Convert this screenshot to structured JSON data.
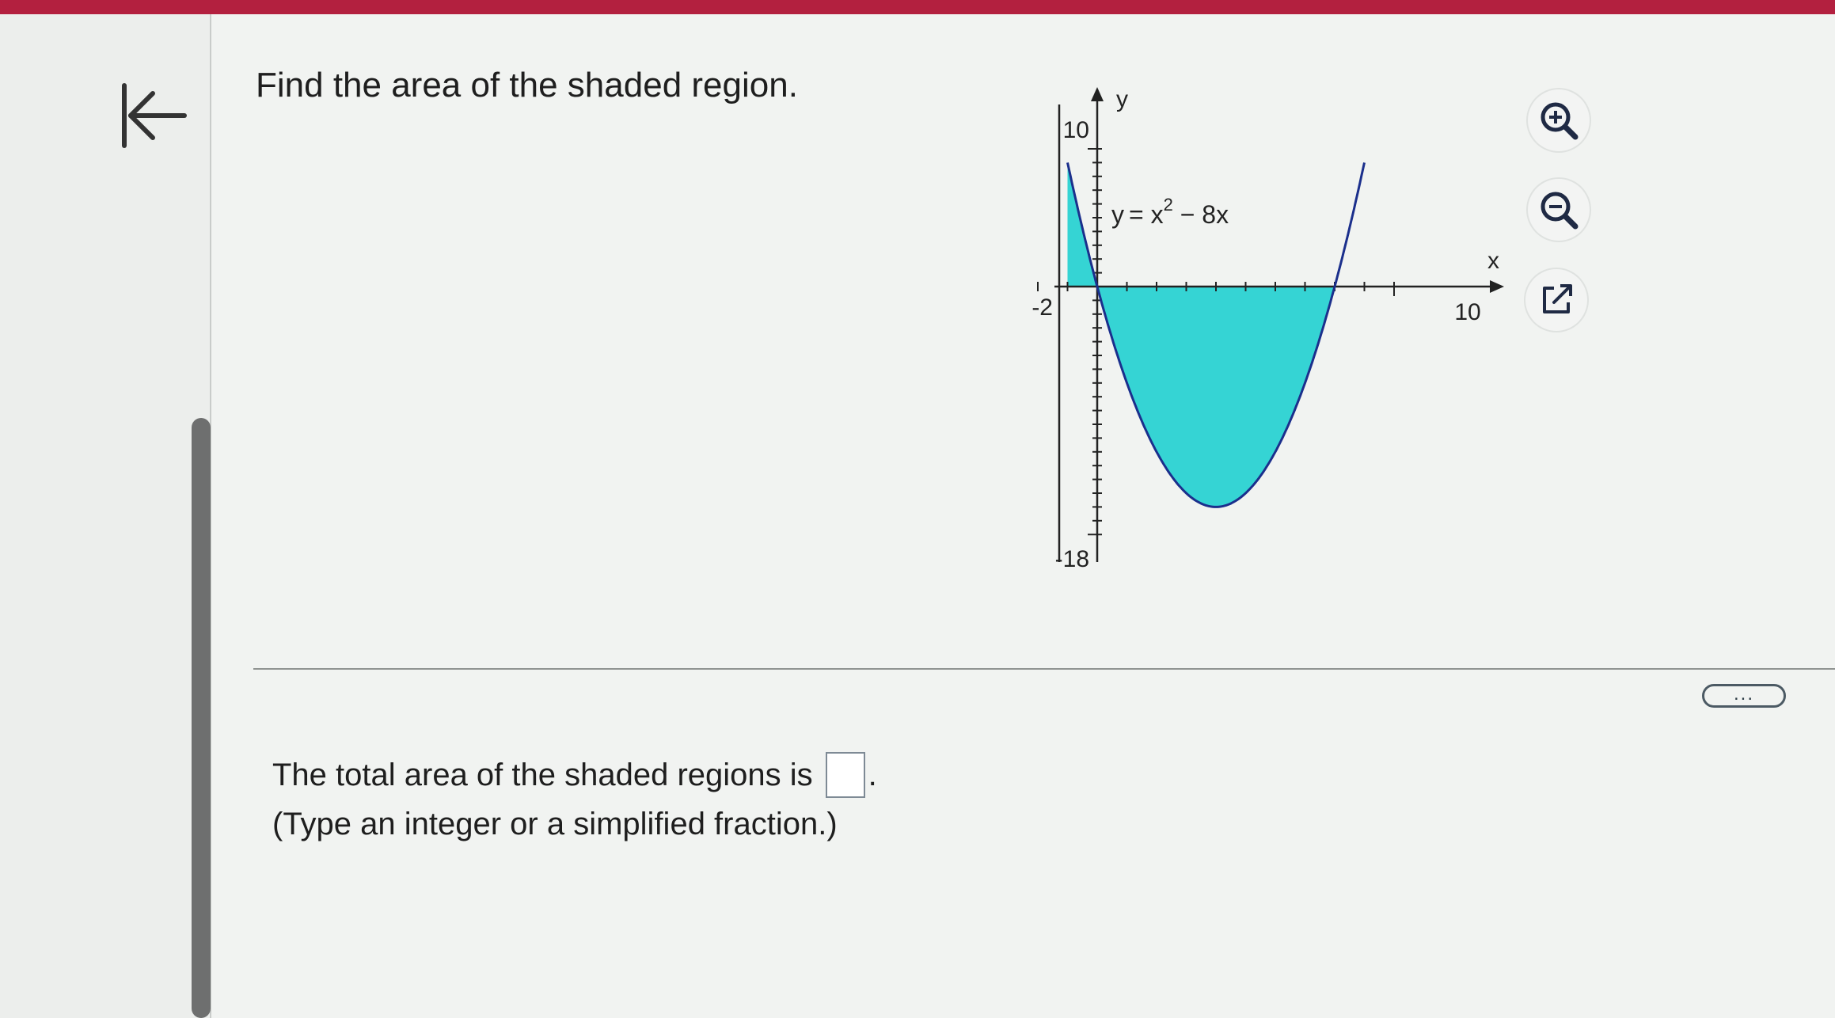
{
  "question": {
    "prompt": "Find the area of the shaded region."
  },
  "graph": {
    "function_label_y": "y",
    "function_label_eq": "= x",
    "function_label_exp": "2",
    "function_label_tail": " − 8x",
    "y_axis_label": "y",
    "x_axis_label": "x",
    "tick_label_ymax": "10",
    "tick_label_ymin": "-18",
    "tick_label_xmin": "-2",
    "tick_label_xmax": "10",
    "fill_color": "#35d4d4",
    "curve_color": "#1b2f8c"
  },
  "chart_data": {
    "type": "area",
    "function": "y = x^2 - 8x",
    "xlim": [
      -2,
      10
    ],
    "ylim": [
      -18,
      10
    ],
    "x_tick_labels": [
      "-2",
      "10"
    ],
    "y_tick_labels": [
      "10",
      "-18"
    ],
    "xlabel": "x",
    "ylabel": "y",
    "shaded_intervals": [
      [
        -1,
        0
      ],
      [
        0,
        8
      ]
    ],
    "zeros": [
      0,
      8
    ],
    "vertex": [
      4,
      -16
    ]
  },
  "toolbar": {
    "zoom_in_icon": "zoom-in-icon",
    "zoom_out_icon": "zoom-out-icon",
    "popout_icon": "external-link-icon"
  },
  "more_button": {
    "label": "..."
  },
  "answer": {
    "prefix": "The total area of the shaded regions is",
    "suffix": ".",
    "hint": "(Type an integer or a simplified fraction.)",
    "value": ""
  }
}
